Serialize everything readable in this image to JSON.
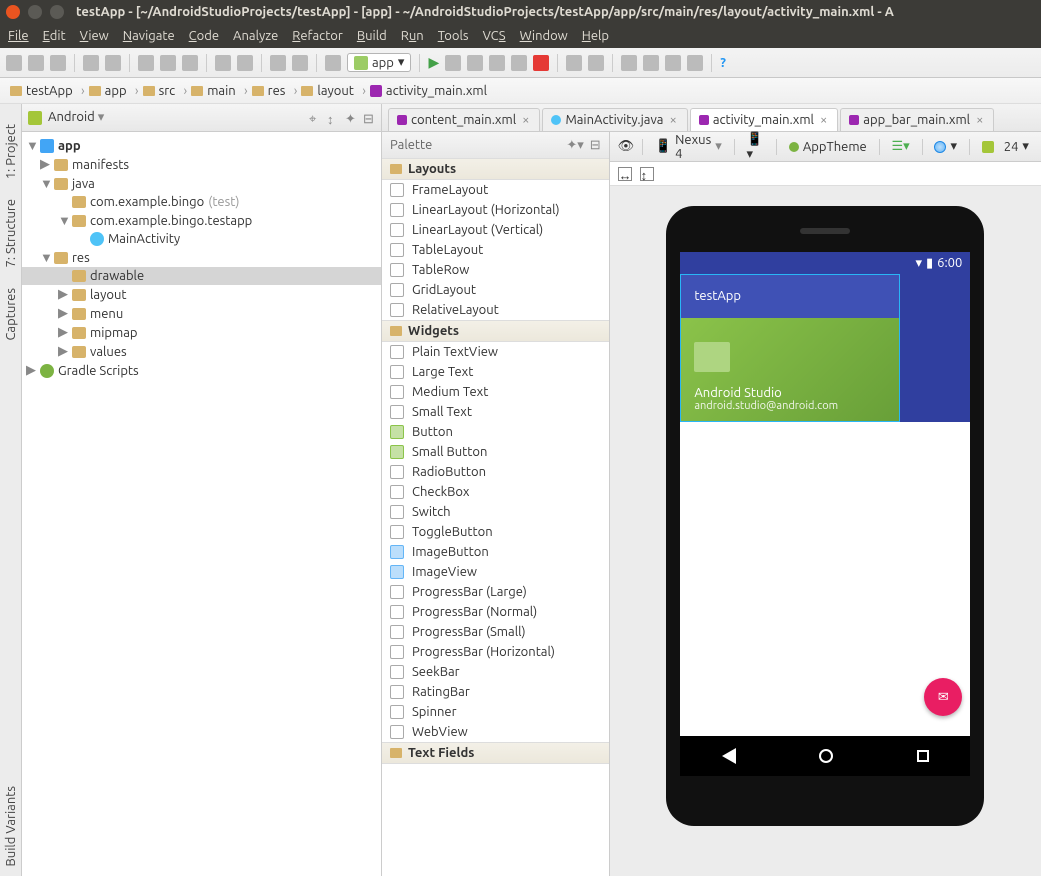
{
  "window": {
    "title": "testApp - [~/AndroidStudioProjects/testApp] - [app] - ~/AndroidStudioProjects/testApp/app/src/main/res/layout/activity_main.xml - A"
  },
  "menu": [
    "File",
    "Edit",
    "View",
    "Navigate",
    "Code",
    "Analyze",
    "Refactor",
    "Build",
    "Run",
    "Tools",
    "VCS",
    "Window",
    "Help"
  ],
  "module_selector": "app",
  "breadcrumb": [
    "testApp",
    "app",
    "src",
    "main",
    "res",
    "layout",
    "activity_main.xml"
  ],
  "side_tabs": [
    "1: Project",
    "7: Structure",
    "Captures",
    "Build Variants"
  ],
  "project_header": "Android",
  "tree": [
    {
      "lvl": 0,
      "exp": "▼",
      "icon": "mod",
      "label": "app",
      "bold": true
    },
    {
      "lvl": 1,
      "exp": "▶",
      "icon": "dir",
      "label": "manifests"
    },
    {
      "lvl": 1,
      "exp": "▼",
      "icon": "dir",
      "label": "java"
    },
    {
      "lvl": 2,
      "exp": "",
      "icon": "pkg",
      "label": "com.example.bingo",
      "dim": "(test)"
    },
    {
      "lvl": 2,
      "exp": "▼",
      "icon": "pkg",
      "label": "com.example.bingo.testapp"
    },
    {
      "lvl": 3,
      "exp": "",
      "icon": "cls",
      "label": "MainActivity"
    },
    {
      "lvl": 1,
      "exp": "▼",
      "icon": "dir",
      "label": "res"
    },
    {
      "lvl": 2,
      "exp": "",
      "icon": "dir",
      "label": "drawable",
      "sel": true
    },
    {
      "lvl": 2,
      "exp": "▶",
      "icon": "dir",
      "label": "layout"
    },
    {
      "lvl": 2,
      "exp": "▶",
      "icon": "dir",
      "label": "menu"
    },
    {
      "lvl": 2,
      "exp": "▶",
      "icon": "dir",
      "label": "mipmap"
    },
    {
      "lvl": 2,
      "exp": "▶",
      "icon": "dir",
      "label": "values"
    },
    {
      "lvl": 0,
      "exp": "▶",
      "icon": "grad",
      "label": "Gradle Scripts"
    }
  ],
  "editor_tabs": [
    {
      "label": "content_main.xml",
      "active": false,
      "icon": "xml"
    },
    {
      "label": "MainActivity.java",
      "active": false,
      "icon": "cls"
    },
    {
      "label": "activity_main.xml",
      "active": true,
      "icon": "xml"
    },
    {
      "label": "app_bar_main.xml",
      "active": false,
      "icon": "xml"
    }
  ],
  "palette": {
    "title": "Palette",
    "groups": [
      {
        "name": "Layouts",
        "items": [
          "FrameLayout",
          "LinearLayout (Horizontal)",
          "LinearLayout (Vertical)",
          "TableLayout",
          "TableRow",
          "GridLayout",
          "RelativeLayout"
        ]
      },
      {
        "name": "Widgets",
        "items": [
          "Plain TextView",
          "Large Text",
          "Medium Text",
          "Small Text",
          "Button",
          "Small Button",
          "RadioButton",
          "CheckBox",
          "Switch",
          "ToggleButton",
          "ImageButton",
          "ImageView",
          "ProgressBar (Large)",
          "ProgressBar (Normal)",
          "ProgressBar (Small)",
          "ProgressBar (Horizontal)",
          "SeekBar",
          "RatingBar",
          "Spinner",
          "WebView"
        ]
      },
      {
        "name": "Text Fields",
        "items": []
      }
    ]
  },
  "design_toolbar": {
    "device": "Nexus 4",
    "theme": "AppTheme",
    "api": "24"
  },
  "preview": {
    "status_time": "6:00",
    "app_title": "testApp",
    "drawer_name": "Android Studio",
    "drawer_email": "android.studio@android.com"
  }
}
